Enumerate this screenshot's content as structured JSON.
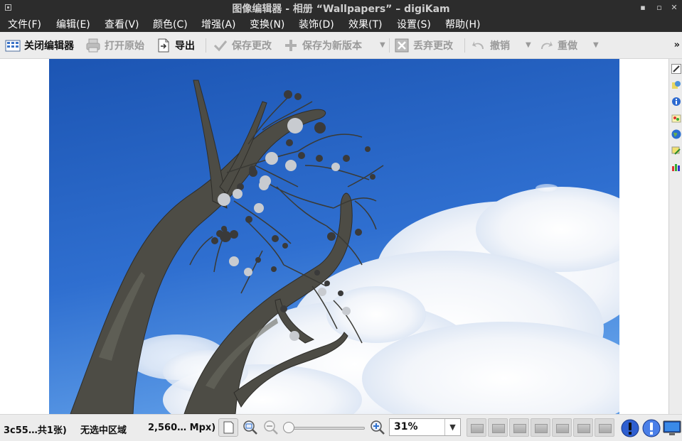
{
  "window": {
    "title": "图像编辑器 - 相册 “Wallpapers” – digiKam",
    "controls": {
      "minimize": "▪",
      "maximize": "▫",
      "close": "✕"
    }
  },
  "menu": [
    {
      "label": "文件(F)"
    },
    {
      "label": "编辑(E)"
    },
    {
      "label": "查看(V)"
    },
    {
      "label": "颜色(C)"
    },
    {
      "label": "增强(A)"
    },
    {
      "label": "变换(N)"
    },
    {
      "label": "装饰(D)"
    },
    {
      "label": "效果(T)"
    },
    {
      "label": "设置(S)"
    },
    {
      "label": "帮助(H)"
    }
  ],
  "toolbar": {
    "close_editor": "关闭编辑器",
    "open_original": "打开原始",
    "export": "导出",
    "save_changes": "保存更改",
    "save_as_new": "保存为新版本",
    "discard": "丢弃更改",
    "undo": "撤销",
    "redo": "重做",
    "more": "»"
  },
  "statusbar": {
    "file_info": "3c55…共1张)",
    "selection": "无选中区域",
    "dimensions": "2,560… Mpx)",
    "zoom_value": "31%",
    "zoom_dropdown": "▼",
    "zoom_level": 0.31
  },
  "colors": {
    "titlebar": "#2c2c2c",
    "toolbar": "#ececec",
    "sky_top": "#1f5ab8",
    "sky_bottom": "#4b8de0"
  }
}
